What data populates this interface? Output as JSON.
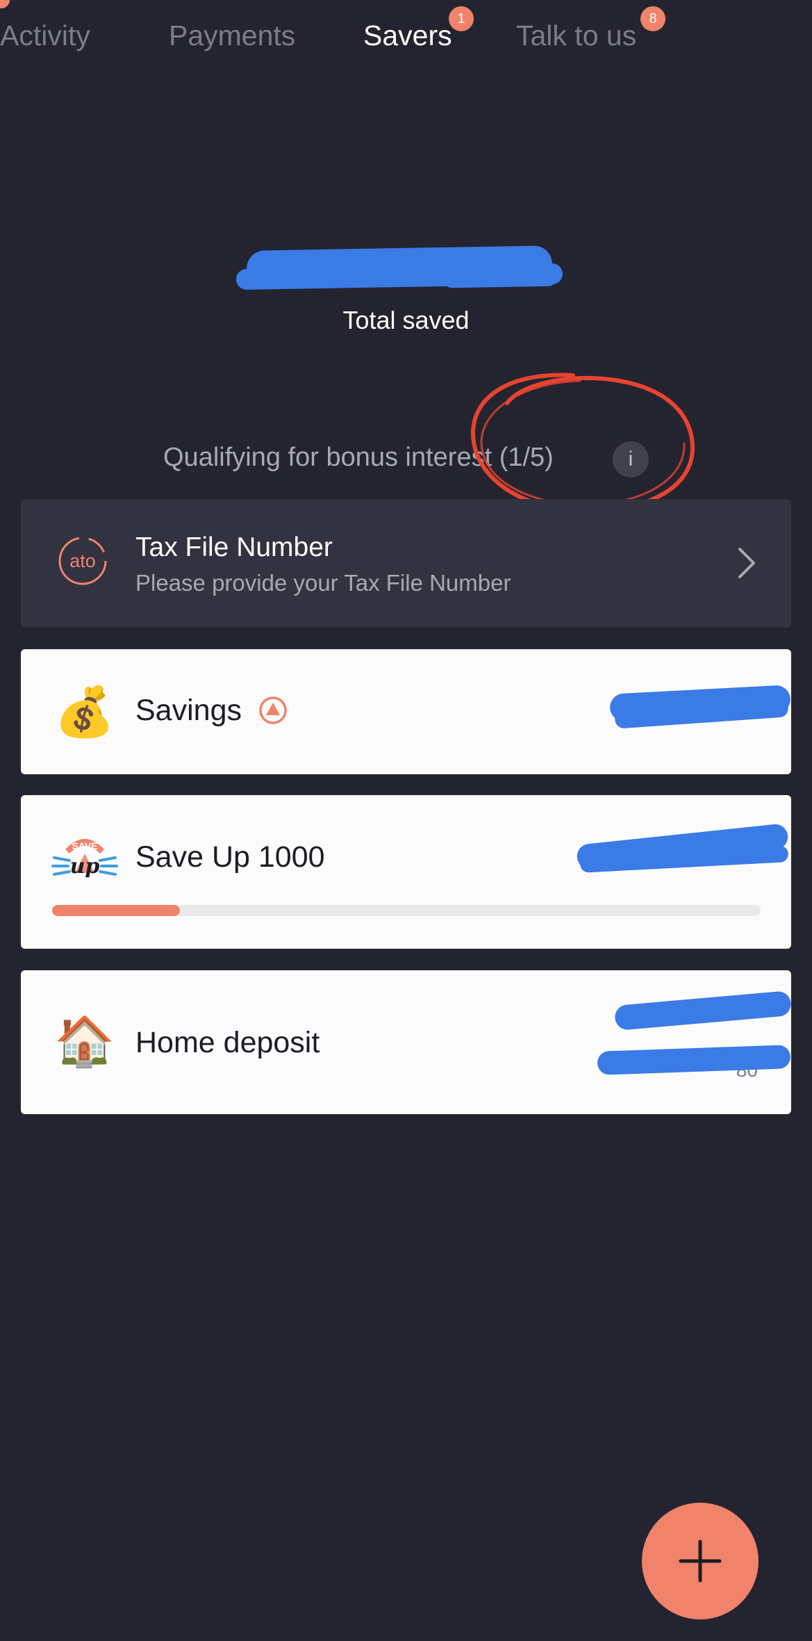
{
  "tabs": [
    {
      "label": "Activity",
      "badge": ""
    },
    {
      "label": "Payments",
      "badge": ""
    },
    {
      "label": "Savers",
      "badge": "1"
    },
    {
      "label": "Talk to us",
      "badge": "8"
    }
  ],
  "summary": {
    "total_amount": "$",
    "total_label": "Total saved"
  },
  "bonus": {
    "label": "Qualifying for bonus interest (1/5)",
    "info_glyph": "i"
  },
  "tfn": {
    "title": "Tax File Number",
    "subtitle": "Please provide your Tax File Number",
    "icon": "ato-icon"
  },
  "savers": [
    {
      "name": "Savings",
      "icon": "money-bag-icon"
    },
    {
      "name": "Save Up 1000",
      "icon": "save-up-icon",
      "progress": 0.18
    },
    {
      "name": "Home deposit",
      "icon": "house-icon",
      "target_suffix": "80"
    }
  ],
  "colors": {
    "background": "#242430",
    "accent": "#f0836a",
    "redaction": "#3a7be6",
    "annotation": "#e8432f"
  }
}
